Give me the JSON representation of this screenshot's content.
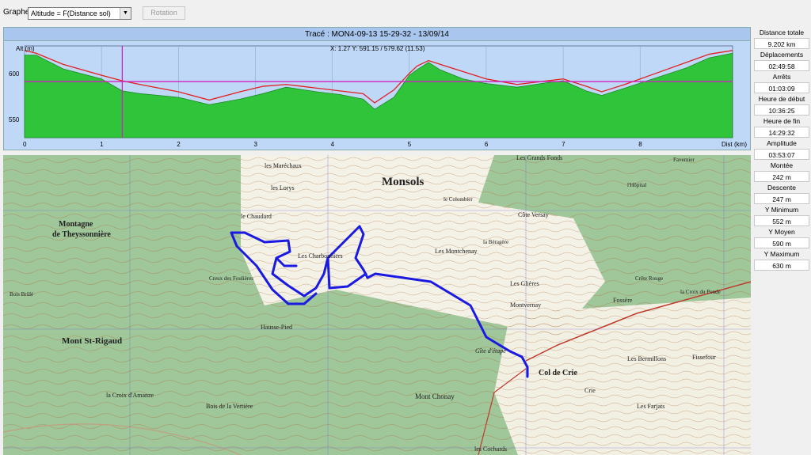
{
  "toolbar": {
    "graph_label": "Graphe",
    "graph_select_value": "Altitude = F(Distance sol)",
    "rotation_label": "Rotation"
  },
  "profile": {
    "title": "Tracé : MON4-09-13 15-29-32 - 13/09/14",
    "cursor_readout": "X: 1.27 Y: 591.15 / 579.62 (11.53)",
    "y_axis_label": "Alt (m)",
    "x_axis_label": "Dist (km)",
    "y_ticks": [
      "600",
      "550"
    ],
    "x_ticks": [
      "0",
      "1",
      "2",
      "3",
      "4",
      "5",
      "6",
      "7",
      "8"
    ],
    "fill_color": "#2fc43a",
    "line_color": "#e02020",
    "cursor_color": "#d020c0"
  },
  "chart_data": {
    "type": "area",
    "xlabel": "Dist (km)",
    "ylabel": "Alt (m)",
    "xlim": [
      0,
      9.202
    ],
    "ylim": [
      530,
      630
    ],
    "x": [
      0,
      0.15,
      0.5,
      1.0,
      1.27,
      1.5,
      2.0,
      2.4,
      2.8,
      3.1,
      3.4,
      3.8,
      4.1,
      4.4,
      4.55,
      4.8,
      5.0,
      5.1,
      5.25,
      5.4,
      5.7,
      6.0,
      6.4,
      6.8,
      7.0,
      7.3,
      7.5,
      7.8,
      8.2,
      8.6,
      8.9,
      9.2
    ],
    "series": [
      {
        "values": [
          620,
          620,
          605,
          594,
          581,
          578,
          574,
          566,
          572,
          578,
          585,
          580,
          577,
          572,
          561,
          574,
          598,
          604,
          612,
          604,
          594,
          589,
          585,
          590,
          592,
          581,
          576,
          584,
          595,
          606,
          617,
          622
        ]
      },
      {
        "values": [
          625,
          622,
          610,
          598,
          592,
          588,
          580,
          571,
          580,
          586,
          588,
          584,
          581,
          578,
          568,
          582,
          600,
          608,
          614,
          610,
          602,
          594,
          588,
          592,
          594,
          586,
          580,
          588,
          600,
          612,
          621,
          625
        ]
      }
    ],
    "cursor_x": 1.27,
    "reference_y": 591.15
  },
  "stats": [
    {
      "label": "Distance totale",
      "value": "9.202 km"
    },
    {
      "label": "Déplacements",
      "value": "02:49:58"
    },
    {
      "label": "Arrêts",
      "value": "01:03:09"
    },
    {
      "label": "Heure de début",
      "value": "10:36:25"
    },
    {
      "label": "Heure de fin",
      "value": "14:29:32"
    },
    {
      "label": "Amplitude",
      "value": "03:53:07"
    },
    {
      "label": "Montée",
      "value": "242 m"
    },
    {
      "label": "Descente",
      "value": "247 m"
    },
    {
      "label": "Y Minimum",
      "value": "552 m"
    },
    {
      "label": "Y Moyen",
      "value": "590 m"
    },
    {
      "label": "Y Maximum",
      "value": "630 m"
    }
  ],
  "map": {
    "track_color": "#1a1ae0",
    "places": {
      "monsols": "Monsols",
      "mont_st_rigaud": "Mont St-Rigaud",
      "montagne": "Montagne",
      "theyssonniere": "de Theyssonnière",
      "col_de_crie": "Col de Crie",
      "mont_chonay": "Mont Chonay",
      "charbonniers": "Les Charbonniers",
      "montchenay": "Les Montchenay",
      "glieres": "Les Glières",
      "bermillons": "Les Bermillons",
      "crie": "Crie",
      "farjats": "Les Farjats",
      "fossere": "Fossère",
      "montvernay": "Montvernay",
      "creux_foulieres": "Creux des Foulières",
      "hausse_pied": "Hausse-Pied",
      "marechaux": "les Maréchaux",
      "lorys": "les Lorys",
      "chaudard": "le Chaudard",
      "grands_fonds": "Les Grands Fonds",
      "cote_versay": "Côte Versay",
      "bois_vertiere": "Bois de la Vertière",
      "croix_amanze": "la Croix d'Amanze",
      "crete_rouge": "Crête Rouge",
      "bois_brule": "Bois Brûlé",
      "gite": "Gîte d'étape",
      "cocharde": "les Cochards",
      "hopital": "l'Hôpital",
      "fissefour": "Fissefour",
      "favernier": "Favernier",
      "colombier": "le Colombier",
      "beragere": "la Béragère",
      "croix_pondes": "la Croix du Ponde"
    }
  }
}
